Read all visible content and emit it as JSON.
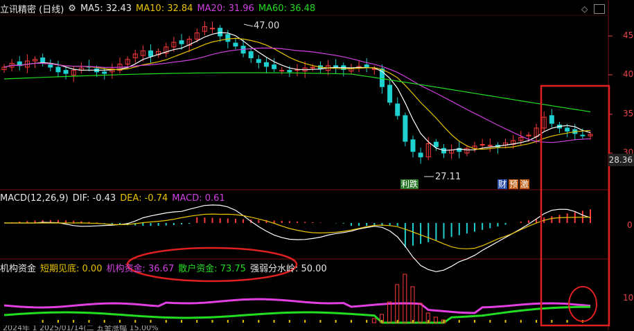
{
  "main": {
    "title": "立讯精密 (日线)",
    "ma_icon": "settings-dropdown-icon",
    "ma5": "MA5: 32.43",
    "ma10": "MA10: 32.84",
    "ma20": "MA20: 31.96",
    "ma60": "MA60: 36.48",
    "high_label": "47.00",
    "low_label": "27.11",
    "current_price": "28.36",
    "axis": [
      "45",
      "40",
      "35",
      "30"
    ],
    "badges": [
      "利",
      "跌",
      "财",
      "预",
      "激"
    ]
  },
  "macd": {
    "title": "MACD(12,26,9)",
    "dif": "DIF: -0.43",
    "dea": "DEA: -0.74",
    "macd": "MACD: 0.61",
    "axis": [
      "0"
    ]
  },
  "fund": {
    "title": "机构资金",
    "short": "短期见底: 0.00",
    "inst": "机构资金: 36.67",
    "retail": "散户资金: 73.75",
    "water": "强弱分水岭: 50.00",
    "axis": [
      "10"
    ],
    "bottom_text": "2024年 1 2025/01/14(二 五金涨幅 15.00%"
  },
  "colors": {
    "up": "#ff3b3b",
    "down": "#1fd1d1",
    "ma5": "#ffffff",
    "ma10": "#e8c400",
    "ma20": "#d040e0",
    "ma60": "#22dd22",
    "annot": "#e02020"
  }
}
